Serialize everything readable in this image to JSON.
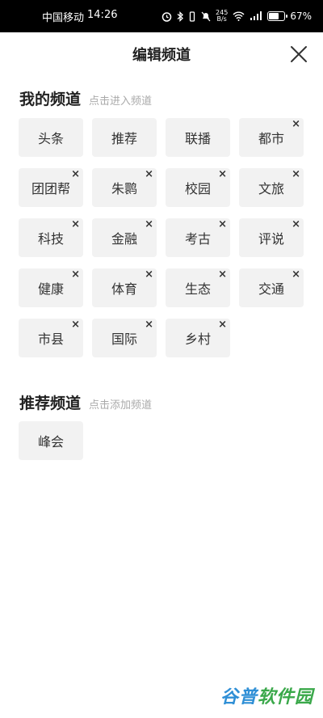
{
  "status_bar": {
    "carrier": "中国移动",
    "time": "14:26",
    "speed_value": "245",
    "speed_unit": "B/s",
    "battery_percent": "67%",
    "battery_level": 0.67,
    "icons": [
      "alarm-icon",
      "bluetooth-icon",
      "vibrate-icon",
      "mute-icon",
      "wifi-icon",
      "signal-icon",
      "battery-icon"
    ]
  },
  "header": {
    "title": "编辑频道",
    "close_icon": "close-icon"
  },
  "my_channels": {
    "title": "我的频道",
    "hint": "点击进入频道",
    "items": [
      {
        "label": "头条",
        "removable": false
      },
      {
        "label": "推荐",
        "removable": false
      },
      {
        "label": "联播",
        "removable": false
      },
      {
        "label": "都市",
        "removable": true
      },
      {
        "label": "团团帮",
        "removable": true
      },
      {
        "label": "朱鹮",
        "removable": true
      },
      {
        "label": "校园",
        "removable": true
      },
      {
        "label": "文旅",
        "removable": true
      },
      {
        "label": "科技",
        "removable": true
      },
      {
        "label": "金融",
        "removable": true
      },
      {
        "label": "考古",
        "removable": true
      },
      {
        "label": "评说",
        "removable": true
      },
      {
        "label": "健康",
        "removable": true
      },
      {
        "label": "体育",
        "removable": true
      },
      {
        "label": "生态",
        "removable": true
      },
      {
        "label": "交通",
        "removable": true
      },
      {
        "label": "市县",
        "removable": true
      },
      {
        "label": "国际",
        "removable": true
      },
      {
        "label": "乡村",
        "removable": true
      }
    ],
    "remove_glyph": "×"
  },
  "recommended_channels": {
    "title": "推荐频道",
    "hint": "点击添加频道",
    "items": [
      {
        "label": "峰会"
      }
    ]
  },
  "watermark": {
    "part1": "谷普",
    "part2": "软件园"
  }
}
